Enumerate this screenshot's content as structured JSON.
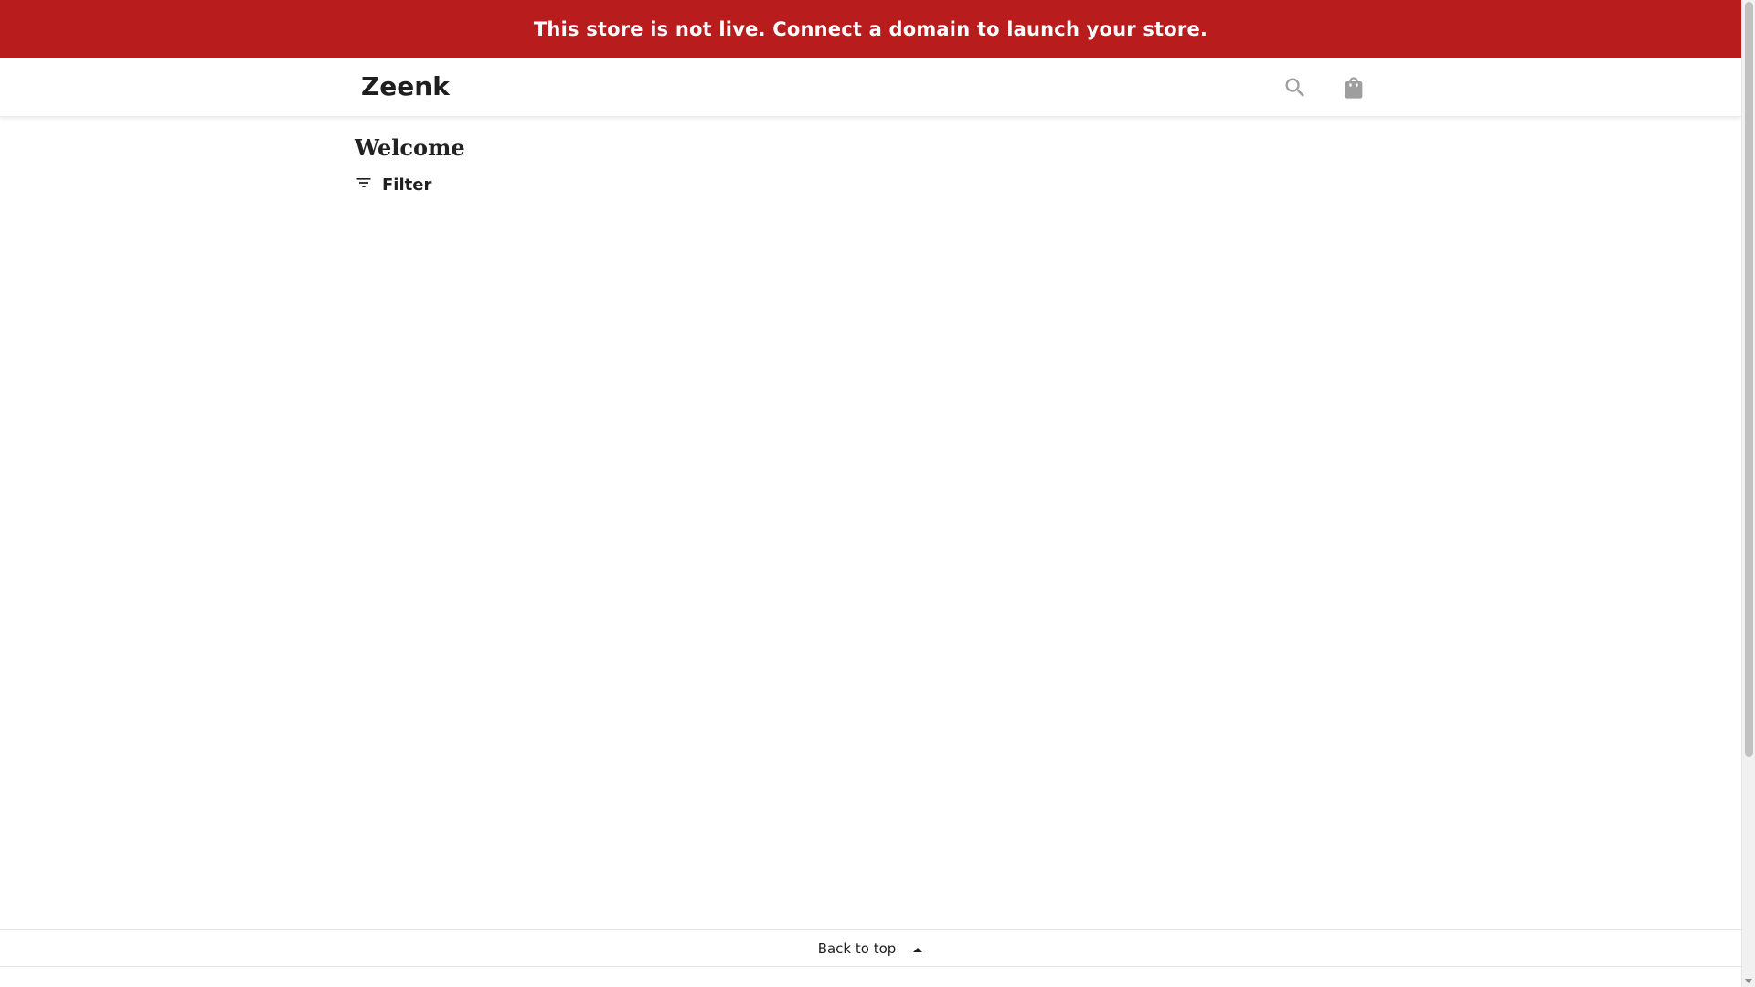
{
  "banner": {
    "text": "This store is not live. Connect a domain to launch your store."
  },
  "header": {
    "brand": "Zeenk",
    "search_icon": "search-icon",
    "cart_icon": "shopping-bag-icon"
  },
  "main": {
    "title": "Welcome",
    "filter_label": "Filter",
    "filter_icon": "filter-icon"
  },
  "footer": {
    "back_to_top_label": "Back to top",
    "back_to_top_icon": "caret-up-icon"
  },
  "colors": {
    "banner_bg": "#b91c1c",
    "banner_text": "#ffffff",
    "icon_gray": "#9e9e9e"
  }
}
